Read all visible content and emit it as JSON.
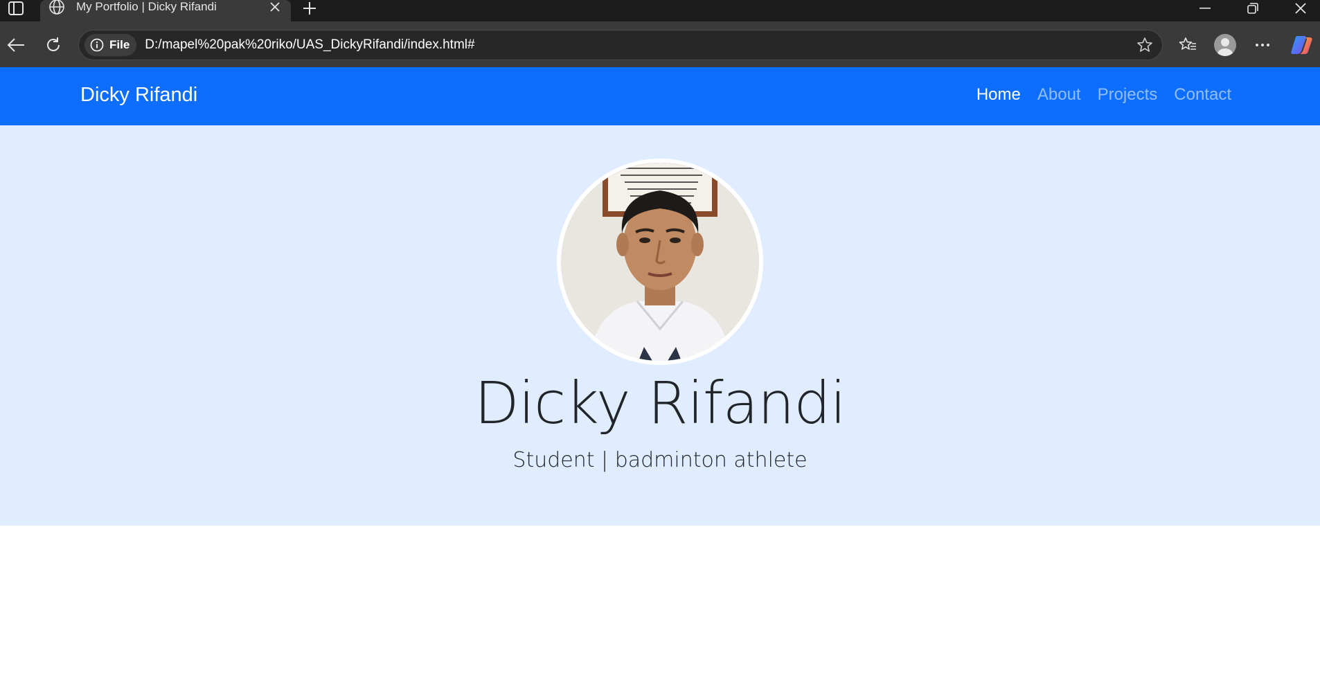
{
  "browser": {
    "tab_title": "My Portfolio | Dicky Rifandi",
    "site_info_label": "File",
    "url": "D:/mapel%20pak%20riko/UAS_DickyRifandi/index.html#"
  },
  "navbar": {
    "brand": "Dicky Rifandi",
    "links": [
      {
        "label": "Home",
        "active": true
      },
      {
        "label": "About",
        "active": false
      },
      {
        "label": "Projects",
        "active": false
      },
      {
        "label": "Contact",
        "active": false
      }
    ]
  },
  "hero": {
    "name": "Dicky Rifandi",
    "tagline": "Student | badminton athlete"
  },
  "colors": {
    "navbar": "#0d6efd",
    "hero_background": "#e0ecff",
    "browser_tabbar": "#1c1c1c",
    "browser_toolbar": "#3a3a3a"
  }
}
